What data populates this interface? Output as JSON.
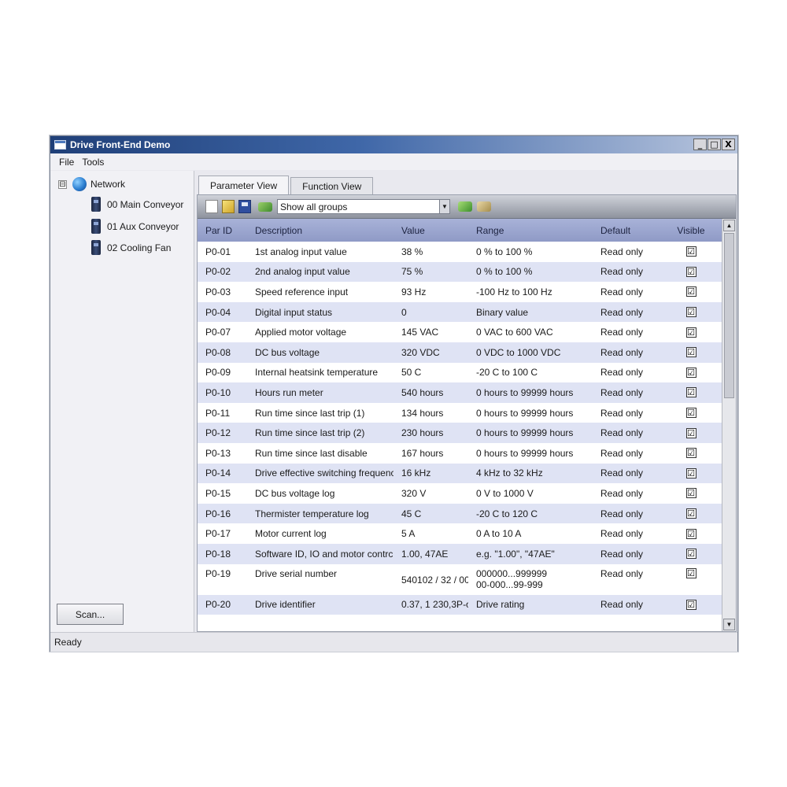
{
  "window": {
    "title": "Drive Front-End Demo",
    "buttons": [
      "_",
      "□",
      "X"
    ]
  },
  "menu": [
    "File",
    "Tools"
  ],
  "tree": {
    "root_expander": "⊟",
    "root_label": "Network",
    "items": [
      "00 Main Conveyor",
      "01 Aux Conveyor",
      "02 Cooling Fan"
    ]
  },
  "scan_button": "Scan...",
  "status": "Ready",
  "tabs": [
    "Parameter View",
    "Function View"
  ],
  "toolbar": {
    "group_filter": "Show all groups",
    "dropdown_glyph": "▼"
  },
  "columns": {
    "id": "Par ID",
    "description": "Description",
    "value": "Value",
    "range": "Range",
    "default": "Default",
    "visible": "Visible"
  },
  "rows": [
    {
      "id": "P0-01",
      "description": "1st analog input value",
      "value": "38 %",
      "range": "0 % to 100 %",
      "default": "Read only",
      "visible": "☑"
    },
    {
      "id": "P0-02",
      "description": "2nd analog input value",
      "value": "75 %",
      "range": "0 % to 100 %",
      "default": "Read only",
      "visible": "☑"
    },
    {
      "id": "P0-03",
      "description": "Speed reference input",
      "value": "93 Hz",
      "range": "-100 Hz to 100 Hz",
      "default": "Read only",
      "visible": "☑"
    },
    {
      "id": "P0-04",
      "description": "Digital input status",
      "value": "0",
      "range": "Binary value",
      "default": "Read only",
      "visible": "☑"
    },
    {
      "id": "P0-07",
      "description": "Applied motor voltage",
      "value": "145 VAC",
      "range": "0 VAC to 600 VAC",
      "default": "Read only",
      "visible": "☑"
    },
    {
      "id": "P0-08",
      "description": "DC bus voltage",
      "value": "320 VDC",
      "range": "0 VDC to 1000 VDC",
      "default": "Read only",
      "visible": "☑"
    },
    {
      "id": "P0-09",
      "description": "Internal heatsink temperature",
      "value": "50 C",
      "range": "-20 C to 100 C",
      "default": "Read only",
      "visible": "☑"
    },
    {
      "id": "P0-10",
      "description": "Hours run meter",
      "value": "540 hours",
      "range": "0 hours to 99999 hours",
      "default": "Read only",
      "visible": "☑"
    },
    {
      "id": "P0-11",
      "description": "Run time since last trip (1)",
      "value": "134 hours",
      "range": "0 hours to 99999 hours",
      "default": "Read only",
      "visible": "☑"
    },
    {
      "id": "P0-12",
      "description": "Run time since last trip (2)",
      "value": "230 hours",
      "range": "0 hours to 99999 hours",
      "default": "Read only",
      "visible": "☑"
    },
    {
      "id": "P0-13",
      "description": "Run time since last disable",
      "value": "167 hours",
      "range": "0 hours to 99999 hours",
      "default": "Read only",
      "visible": "☑"
    },
    {
      "id": "P0-14",
      "description": "Drive effective switching frequenc",
      "value": "16 kHz",
      "range": "4 kHz to 32 kHz",
      "default": "Read only",
      "visible": "☑"
    },
    {
      "id": "P0-15",
      "description": "DC bus voltage log",
      "value": "320 V",
      "range": "0 V to 1000 V",
      "default": "Read only",
      "visible": "☑"
    },
    {
      "id": "P0-16",
      "description": "Thermister temperature log",
      "value": "45 C",
      "range": "-20 C to 120 C",
      "default": "Read only",
      "visible": "☑"
    },
    {
      "id": "P0-17",
      "description": "Motor current log",
      "value": "5 A",
      "range": "0 A to 10 A",
      "default": "Read only",
      "visible": "☑"
    },
    {
      "id": "P0-18",
      "description": "Software ID, IO and motor contrc",
      "value": "1.00, 47AE",
      "range": "e.g. \"1.00\", \"47AE\"",
      "default": "Read only",
      "visible": "☑"
    },
    {
      "id": "P0-19",
      "description": "Drive serial number",
      "value": "540102 / 32 / 00",
      "range": "000000...999999",
      "range2": "00-000...99-999",
      "default": "Read only",
      "visible": "☑"
    },
    {
      "id": "P0-20",
      "description": "Drive identifier",
      "value": "0.37, 1 230,3P-o",
      "range": "Drive rating",
      "default": "Read only",
      "visible": "☑"
    }
  ],
  "scrollbar": {
    "up": "▲",
    "down": "▼"
  }
}
